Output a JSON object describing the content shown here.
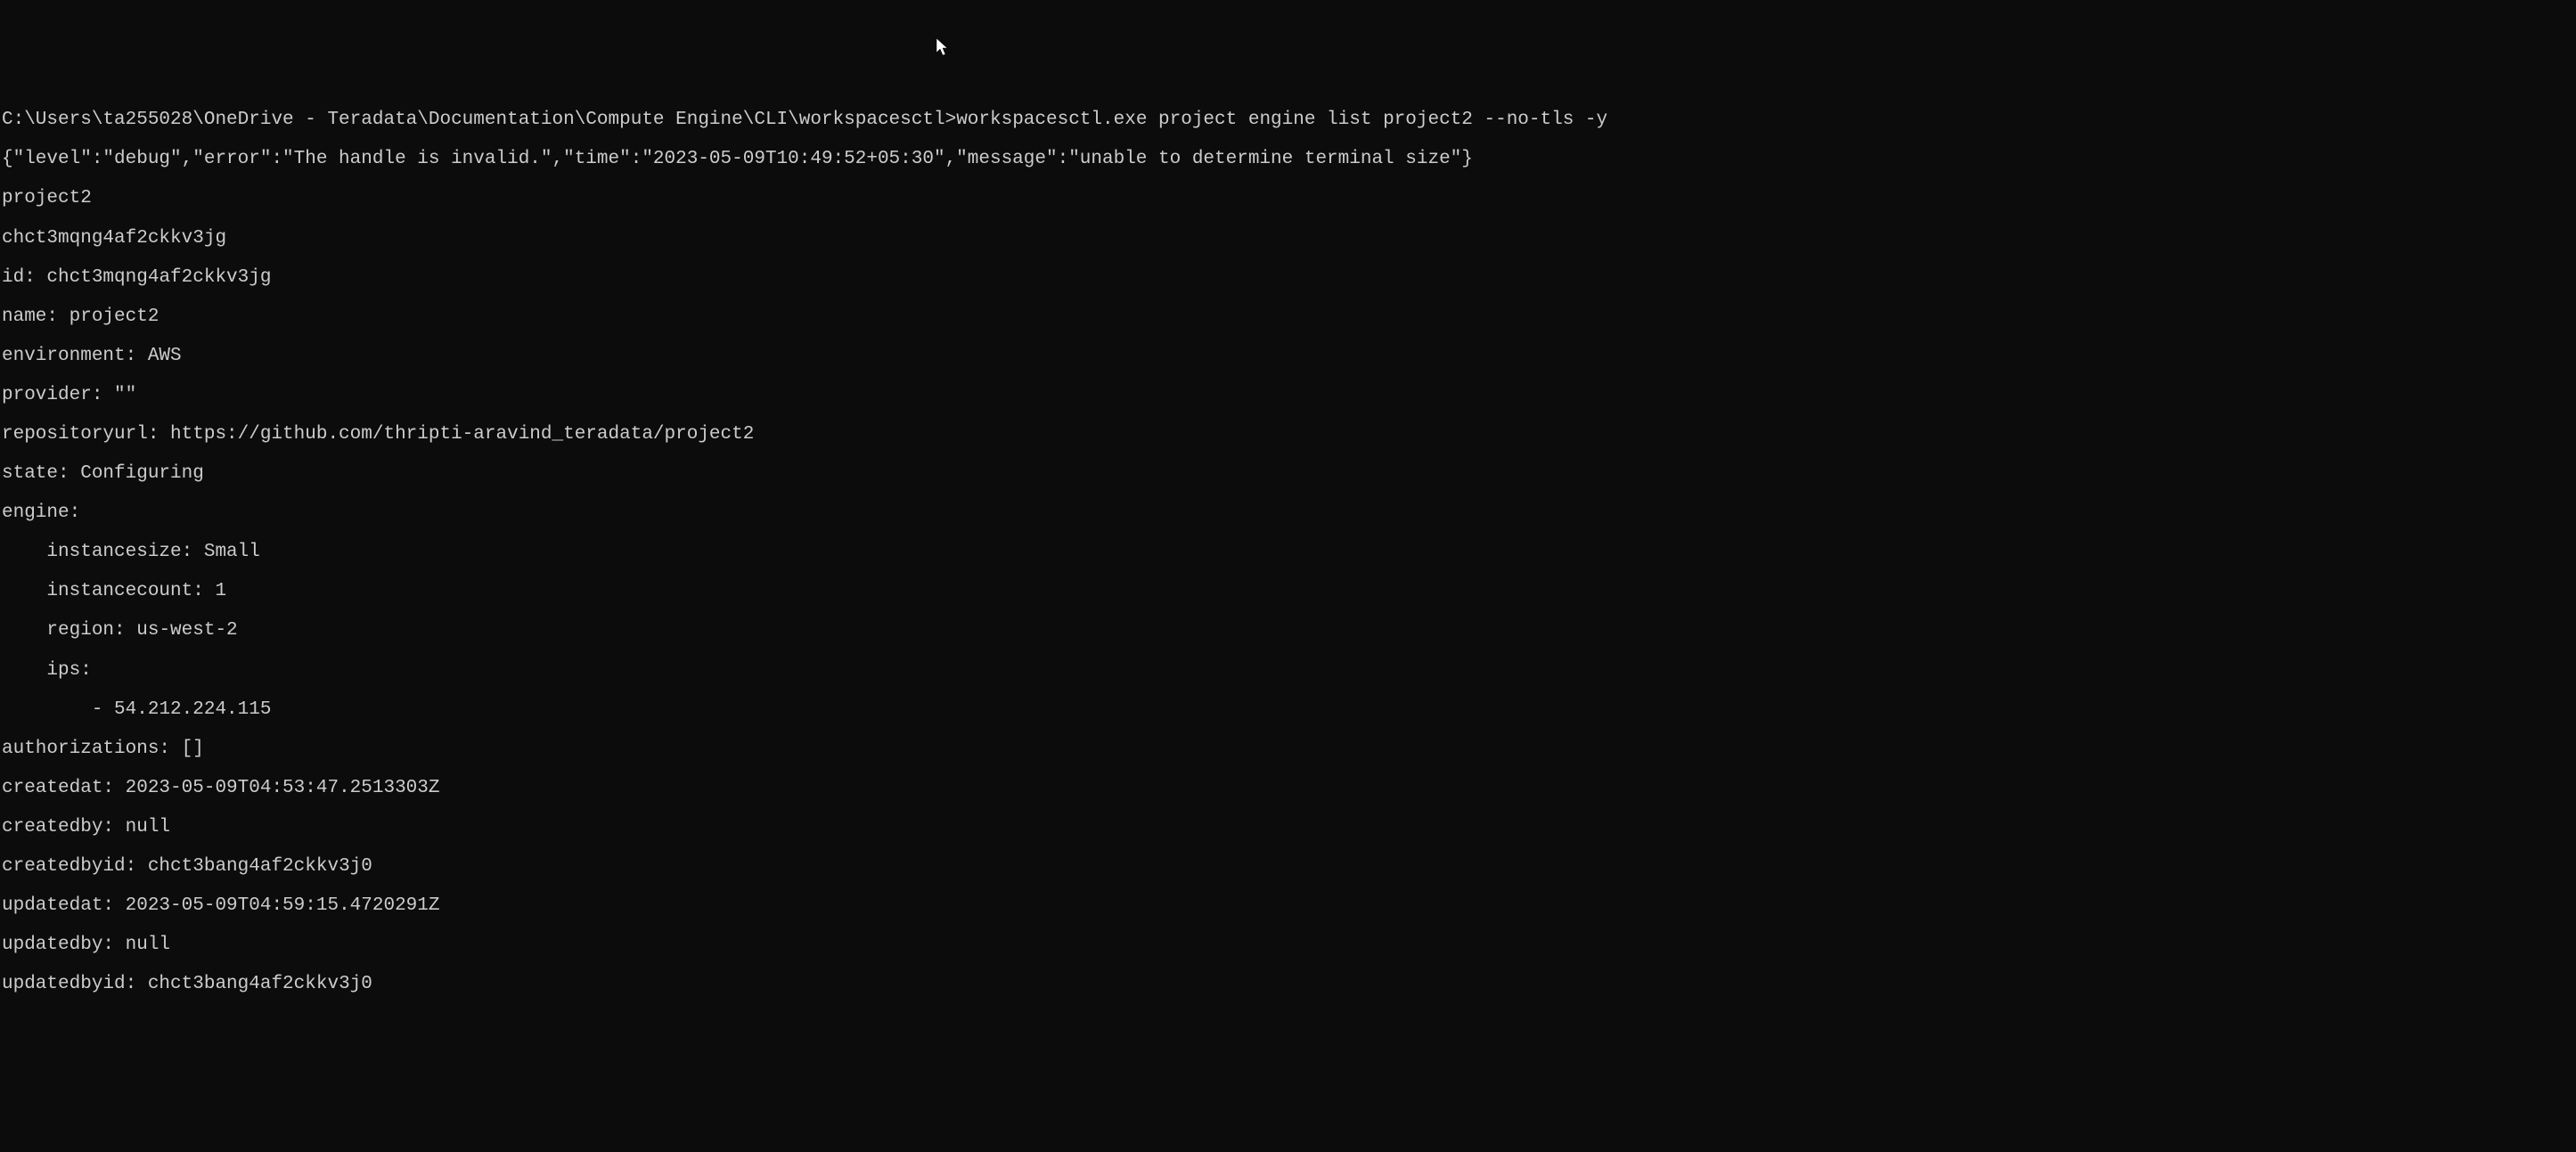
{
  "terminal": {
    "prompt_path": "C:\\Users\\ta255028\\OneDrive - Teradata\\Documentation\\Compute Engine\\CLI\\workspacesctl>",
    "command": "workspacesctl.exe project engine list project2 --no-tls -y",
    "debug_line": "{\"level\":\"debug\",\"error\":\"The handle is invalid.\",\"time\":\"2023-05-09T10:49:52+05:30\",\"message\":\"unable to determine terminal size\"}",
    "output": {
      "project_name": "project2",
      "project_id_short": "chct3mqng4af2ckkv3jg",
      "id_label": "id: ",
      "id_value": "chct3mqng4af2ckkv3jg",
      "name_label": "name: ",
      "name_value": "project2",
      "environment_label": "environment: ",
      "environment_value": "AWS",
      "provider_label": "provider: ",
      "provider_value": "\"\"",
      "repositoryurl_label": "repositoryurl: ",
      "repositoryurl_value": "https://github.com/thripti-aravind_teradata/project2",
      "state_label": "state: ",
      "state_value": "Configuring",
      "engine_label": "engine:",
      "instancesize_label": "    instancesize: ",
      "instancesize_value": "Small",
      "instancecount_label": "    instancecount: ",
      "instancecount_value": "1",
      "region_label": "    region: ",
      "region_value": "us-west-2",
      "ips_label": "    ips:",
      "ips_item_prefix": "        - ",
      "ips_item_value": "54.212.224.115",
      "authorizations_label": "authorizations: ",
      "authorizations_value": "[]",
      "createdat_label": "createdat: ",
      "createdat_value": "2023-05-09T04:53:47.2513303Z",
      "createdby_label": "createdby: ",
      "createdby_value": "null",
      "createdbyid_label": "createdbyid: ",
      "createdbyid_value": "chct3bang4af2ckkv3j0",
      "updatedat_label": "updatedat: ",
      "updatedat_value": "2023-05-09T04:59:15.4720291Z",
      "updatedby_label": "updatedby: ",
      "updatedby_value": "null",
      "updatedbyid_label": "updatedbyid: ",
      "updatedbyid_value": "chct3bang4af2ckkv3j0"
    }
  }
}
